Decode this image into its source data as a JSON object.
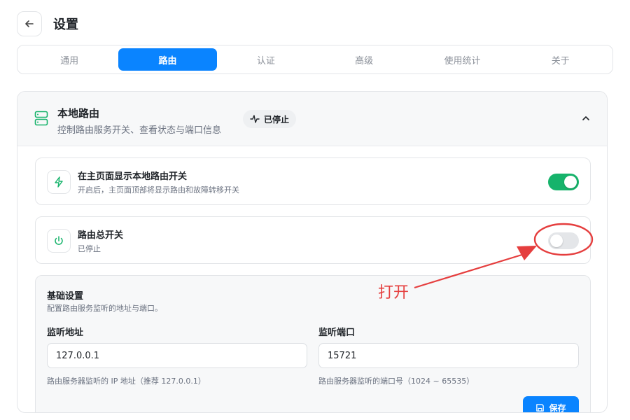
{
  "header": {
    "title": "设置"
  },
  "tabs": [
    {
      "label": "通用",
      "active": false
    },
    {
      "label": "路由",
      "active": true
    },
    {
      "label": "认证",
      "active": false
    },
    {
      "label": "高级",
      "active": false
    },
    {
      "label": "使用统计",
      "active": false
    },
    {
      "label": "关于",
      "active": false
    }
  ],
  "section": {
    "title": "本地路由",
    "subtitle": "控制路由服务开关、查看状态与端口信息",
    "status": "已停止"
  },
  "rows": {
    "show_toggle": {
      "title": "在主页面显示本地路由开关",
      "subtitle": "开启后，主页面顶部将显示路由和故障转移开关",
      "enabled": true
    },
    "master_switch": {
      "title": "路由总开关",
      "subtitle": "已停止",
      "enabled": false
    }
  },
  "basic_settings": {
    "title": "基础设置",
    "subtitle": "配置路由服务监听的地址与端口。",
    "address_label": "监听地址",
    "address_value": "127.0.0.1",
    "address_help": "路由服务器监听的 IP 地址（推荐 127.0.0.1）",
    "port_label": "监听端口",
    "port_value": "15721",
    "port_help": "路由服务器监听的端口号（1024 ~ 65535）",
    "save_label": "保存"
  },
  "annotation": {
    "text": "打开",
    "color": "#e53e3e"
  },
  "colors": {
    "accent": "#0a84ff",
    "toggle_on": "#16b36b",
    "toggle_off": "#e4e6e9"
  }
}
